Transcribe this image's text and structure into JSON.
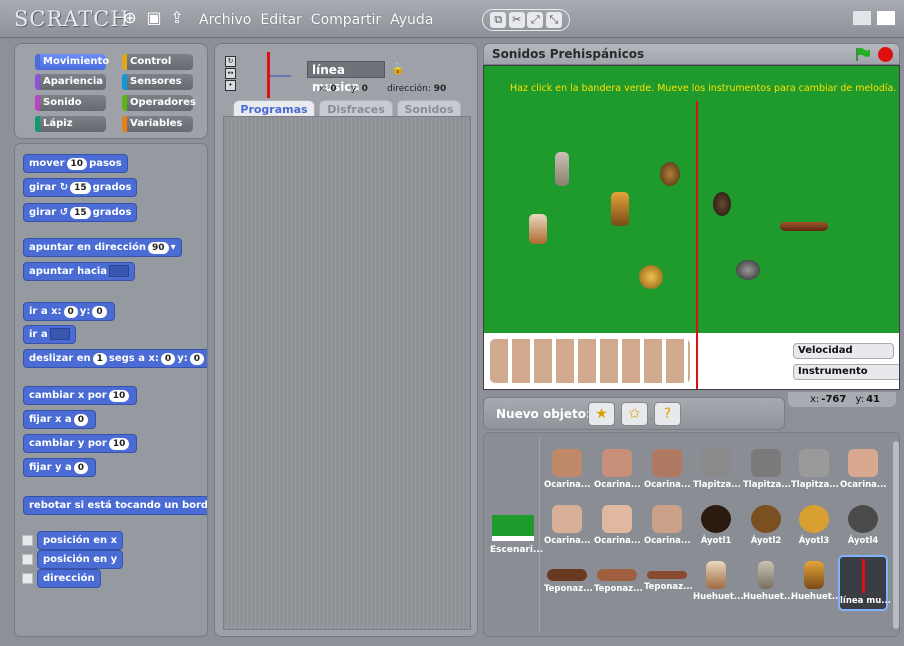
{
  "app": {
    "logo": "SCRATCH",
    "menu": [
      "Archivo",
      "Editar",
      "Compartir",
      "Ayuda"
    ]
  },
  "categories": [
    {
      "label": "Movimiento",
      "color": "#4a6cd4",
      "selected": true
    },
    {
      "label": "Control",
      "color": "#e1a91a"
    },
    {
      "label": "Apariencia",
      "color": "#8a55d7"
    },
    {
      "label": "Sensores",
      "color": "#0d9ad7"
    },
    {
      "label": "Sonido",
      "color": "#bb42c3"
    },
    {
      "label": "Operadores",
      "color": "#5cb712"
    },
    {
      "label": "Lápiz",
      "color": "#0e9a6c"
    },
    {
      "label": "Variables",
      "color": "#ee7d16"
    }
  ],
  "blocks": {
    "mover": {
      "pre": "mover",
      "num": "10",
      "post": "pasos"
    },
    "girar_right": {
      "pre": "girar",
      "num": "15",
      "post": "grados"
    },
    "girar_left": {
      "pre": "girar",
      "num": "15",
      "post": "grados"
    },
    "apuntar_dir": {
      "pre": "apuntar en dirección",
      "num": "90"
    },
    "apuntar_hacia": {
      "pre": "apuntar hacia"
    },
    "ir_a_xy": {
      "pre": "ir a x:",
      "x": "0",
      "mid": "y:",
      "y": "0"
    },
    "ir_a": {
      "pre": "ir a"
    },
    "deslizar": {
      "pre": "deslizar en",
      "secs": "1",
      "mid": "segs a x:",
      "x": "0",
      "mid2": "y:",
      "y": "0"
    },
    "cambiar_x": {
      "pre": "cambiar x por",
      "num": "10"
    },
    "fijar_x": {
      "pre": "fijar x a",
      "num": "0"
    },
    "cambiar_y": {
      "pre": "cambiar y por",
      "num": "10"
    },
    "fijar_y": {
      "pre": "fijar y a",
      "num": "0"
    },
    "rebotar": {
      "pre": "rebotar si está tocando un borde"
    },
    "posicion_x": "posición en x",
    "posicion_y": "posición en y",
    "direccion": "dirección"
  },
  "sprite": {
    "name": "línea musica",
    "x_label": "x:",
    "x": "0",
    "y_label": "y:",
    "y": "0",
    "dir_label": "dirección:",
    "dir": "90"
  },
  "tabs": [
    {
      "label": "Programas",
      "active": true
    },
    {
      "label": "Disfraces"
    },
    {
      "label": "Sonidos"
    }
  ],
  "stage": {
    "title": "Sonidos Prehispánicos",
    "instructions": "Haz click en la bandera verde. Mueve los instrumentos para cambiar de melodía.",
    "sliders": [
      {
        "label": "Velocidad",
        "value": ""
      },
      {
        "label": "Instrumento",
        "value": ""
      }
    ]
  },
  "mouse": {
    "x_label": "x:",
    "x": "-767",
    "y_label": "y:",
    "y": "41"
  },
  "new_sprite": {
    "label": "Nuevo objeto:"
  },
  "stage_tile": "Escenari...",
  "sprites": [
    [
      "Ocarina...",
      "Ocarina...",
      "Ocarina...",
      "Tlapitza...",
      "Tlapitza...",
      "Tlapitza...",
      "Ocarina..."
    ],
    [
      "Ocarina...",
      "Ocarina...",
      "Ocarina...",
      "Áyotl1",
      "Áyotl2",
      "Áyotl3",
      "Áyotl4"
    ],
    [
      "Teponaz...",
      "Teponaz...",
      "Teponaz...",
      "Huehuet...",
      "Huehuet...",
      "Huehuet...",
      "línea mu..."
    ]
  ],
  "colors": {
    "accent": "#4a6cd4",
    "stage_green": "#1f9a2c",
    "line_red": "#e01010",
    "instructions_yellow": "#ffe000",
    "slider_orange": "#ff7a00"
  }
}
